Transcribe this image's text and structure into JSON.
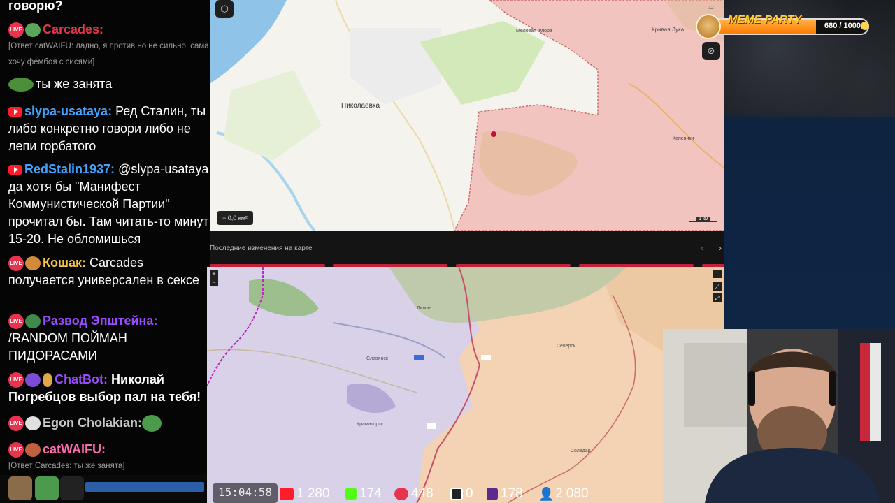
{
  "chat": {
    "top_partial": "говорю?",
    "messages": [
      {
        "user": "Carcades:",
        "reply": "[Ответ catWAIFU: ладно, я против но не сильно, сама хочу фембоя с сисями]",
        "color": "#e2364a"
      },
      {
        "user": "",
        "text": "ты же занята"
      },
      {
        "user": "slypa-usataya:",
        "text": "Ред Сталин, ты либо конкретно говори либо не лепи горбатого",
        "color": "#3fa3ff"
      },
      {
        "user": "RedStalin1937:",
        "text": "@slypa-usataya да хотя бы \"Манифест Коммунистической Партии\" прочитал бы. Там читать-то минут 15-20. Не обломишься",
        "color": "#3fa3ff"
      },
      {
        "user": "Кошак:",
        "text": "Carcades получается универсален в сексе",
        "color": "#f4c542"
      },
      {
        "user": "Развод Эпштейна:",
        "text": "/RANDOM ПОЙМАН ПИДОРАСАМИ",
        "color": "#9a4cff"
      },
      {
        "user": "ChatBot:",
        "text": "Николай Погребцов выбор пал на тебя!",
        "color": "#9a4cff"
      },
      {
        "user": "Egon Cholakian:",
        "text": "",
        "color": "#c9c9c9"
      },
      {
        "user": "catWAIFU:",
        "reply": "[Ответ Carcades: ты же занята]",
        "color": "#ff6bb0"
      }
    ],
    "live_badge": "LIVE"
  },
  "map_top": {
    "labels": [
      "Николаевка",
      "Меловая Флора",
      "Кривая Лука",
      "Капеники",
      "Ясногорка"
    ],
    "area_value": "0,0 км²",
    "scale_label": "1 км",
    "zoom_badge": "12"
  },
  "divider": {
    "title": "Последние изменения на карте",
    "prev_icon": "‹",
    "next_icon": "›"
  },
  "map_bottom": {
    "zoom_in": "+",
    "zoom_out": "−",
    "labels": [
      "Славянск",
      "Краматорск",
      "Северск",
      "Лиман",
      "Соледар"
    ]
  },
  "meme_party": {
    "title": "MEME PARTY",
    "value": "680 / 1000",
    "progress": 0.68
  },
  "stats": {
    "time": "15:04:58",
    "youtube": "1 280",
    "kick": "174",
    "live": "448",
    "rutube": "0",
    "twitch": "178",
    "viewers": "2 080"
  },
  "colors": {
    "accent": "#c0223c",
    "occupied": "#f2c4c0",
    "youtube": "#ff1c2b",
    "kick": "#53fc18",
    "live": "#e8334f",
    "twitch": "#8f5cff"
  }
}
